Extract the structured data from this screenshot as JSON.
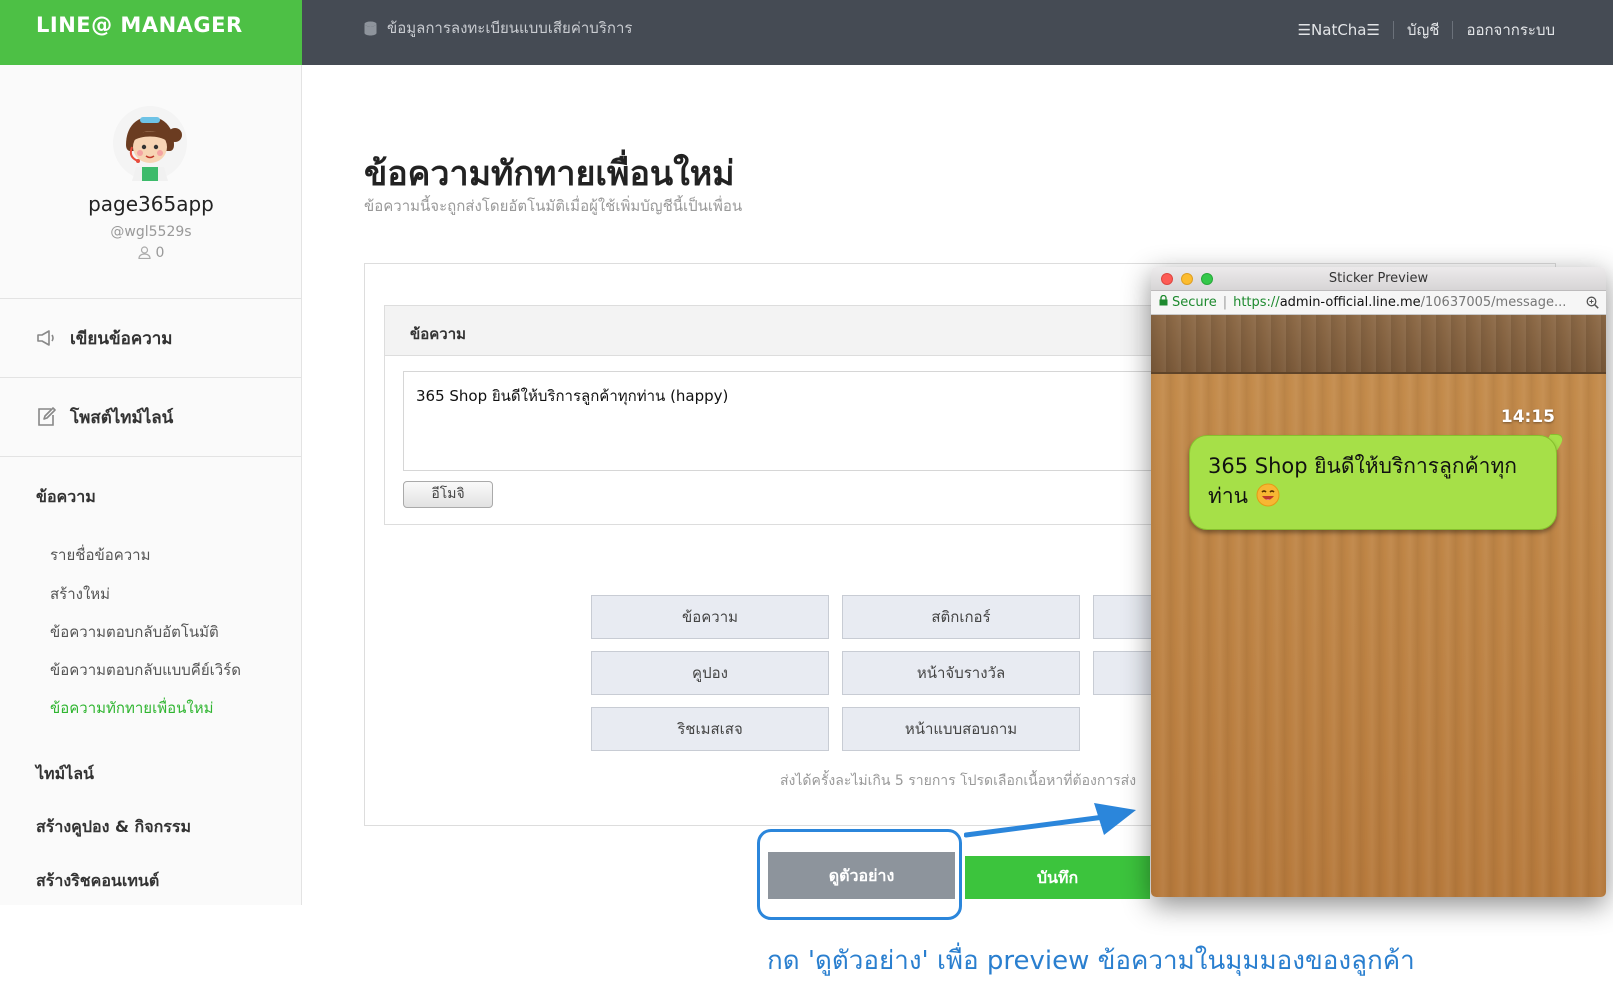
{
  "header": {
    "brand": "LINE@ MANAGER",
    "registration_info": "ข้อมูลการลงทะเบียนแบบเสียค่าบริการ",
    "username": "☰NatCha☰",
    "account": "บัญชี",
    "logout": "ออกจากระบบ"
  },
  "profile": {
    "name": "page365app",
    "id": "@wgl5529s",
    "friend_count": "0"
  },
  "sidebar": {
    "write_message": "เขียนข้อความ",
    "post_timeline": "โพสต์ไทม์ไลน์",
    "messages_section": "ข้อความ",
    "sub_items": [
      "รายชื่อข้อความ",
      "สร้างใหม่",
      "ข้อความตอบกลับอัตโนมัติ",
      "ข้อความตอบกลับแบบคีย์เวิร์ด",
      "ข้อความทักทายเพื่อนใหม่"
    ],
    "timeline": "ไทม์ไลน์",
    "coupon_event": "สร้างคูปอง & กิจกรรม",
    "rich_content": "สร้างริชคอนเทนต์"
  },
  "main": {
    "title": "ข้อความทักทายเพื่อนใหม่",
    "subtitle": "ข้อความนี้จะถูกส่งโดยอัตโนมัติเมื่อผู้ใช้เพิ่มบัญชีนี้เป็นเพื่อน",
    "card_title": "ข้อความ",
    "message_text": "365 Shop ยินดีให้บริการลูกค้าทุกท่าน (happy)",
    "emoji_button": "อีโมจิ",
    "type_buttons": [
      "ข้อความ",
      "สติกเกอร์",
      "คูปอง",
      "หน้าจับรางวัล",
      "ริชเมสเสจ",
      "หน้าแบบสอบถาม"
    ],
    "hint": "ส่งได้ครั้งละไม่เกิน 5 รายการ โปรดเลือกเนื้อหาที่ต้องการส่ง",
    "preview_button": "ดูตัวอย่าง",
    "save_button": "บันทึก"
  },
  "preview_window": {
    "title": "Sticker Preview",
    "secure_label": "Secure",
    "url_scheme": "https://",
    "url_domain": "admin-official.line.me",
    "url_path": "/10637005/message...",
    "time": "14:15",
    "bubble_text": "365 Shop ยินดีให้บริการลูกค้าทุกท่าน",
    "emoji": "happy-face-icon"
  },
  "annotation": {
    "caption": "กด 'ดูตัวอย่าง' เพื่อ preview ข้อความในมุมมองของลูกค้า"
  },
  "colors": {
    "brand_green": "#4dc045",
    "header_dark": "#454b54",
    "active_link": "#2fb530",
    "save_green": "#3cc43d",
    "annotation_blue": "#2b86db"
  }
}
